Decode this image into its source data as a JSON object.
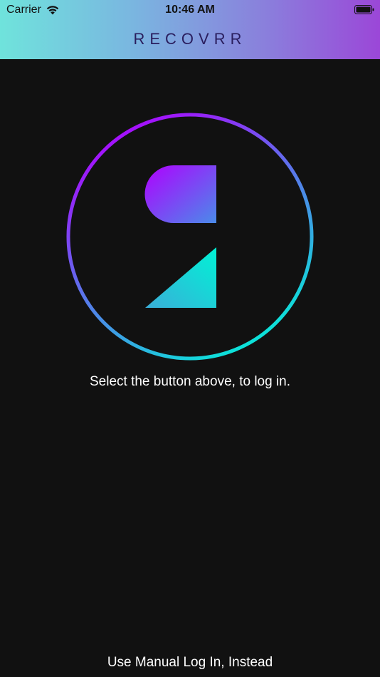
{
  "status_bar": {
    "carrier": "Carrier",
    "time": "10:46 AM"
  },
  "header": {
    "title": "RECOVRR",
    "gradient_start": "#6fe3dc",
    "gradient_end": "#9b47d8"
  },
  "login": {
    "icon": "recovrr-logo-icon",
    "ring_color_start": "#b000ff",
    "ring_color_end": "#00f2d6",
    "prompt": "Select the button above, to log in."
  },
  "footer": {
    "manual_login_label": "Use Manual Log In, Instead"
  }
}
